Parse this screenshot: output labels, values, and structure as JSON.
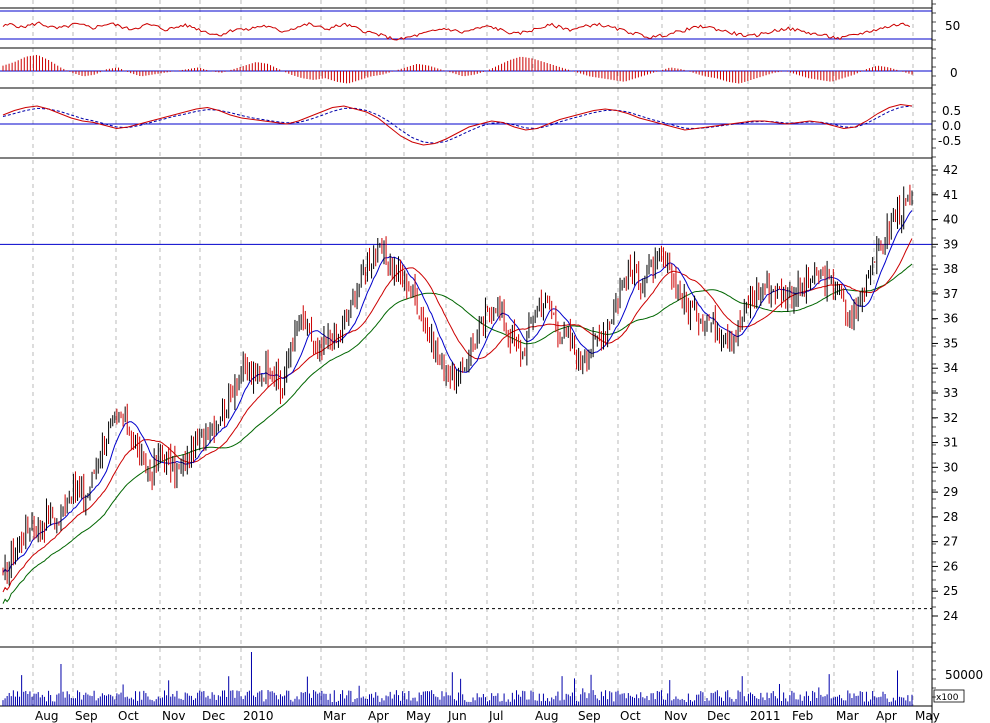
{
  "chart_data": {
    "type": "candlestick",
    "period": {
      "start": "2009-07-15",
      "end": "2011-04-29"
    },
    "x_axis": {
      "labels": [
        "Aug",
        "Sep",
        "Oct",
        "Nov",
        "Dec",
        "2010",
        "Mar",
        "Apr",
        "May",
        "Jun",
        "Jul",
        "Aug",
        "Sep",
        "Oct",
        "Nov",
        "Dec",
        "2011",
        "Feb",
        "Mar",
        "Apr",
        "May"
      ]
    },
    "panels": {
      "oscillator": {
        "ylim": [
          0,
          100
        ],
        "tick_labels": [
          "50"
        ],
        "reference_lines": [
          70,
          30
        ],
        "color": "#cc0000",
        "values": [
          62,
          66,
          60,
          64,
          68,
          62,
          58,
          61,
          66,
          63,
          59,
          64,
          67,
          62,
          57,
          60,
          65,
          62,
          56,
          59,
          64,
          61,
          55,
          50,
          46,
          52,
          58,
          55,
          60,
          63,
          58,
          53,
          57,
          62,
          66,
          61,
          57,
          62,
          65,
          60,
          54,
          50,
          46,
          41,
          38,
          42,
          46,
          50,
          54,
          58,
          55,
          51,
          55,
          59,
          62,
          57,
          52,
          48,
          52,
          56,
          61,
          64,
          60,
          56,
          59,
          63,
          66,
          62,
          58,
          54,
          50,
          46,
          42,
          45,
          48,
          52,
          56,
          60,
          62,
          58,
          54,
          50,
          47,
          44,
          47,
          51,
          55,
          58,
          56,
          52,
          49,
          46,
          43,
          40,
          44,
          48,
          52,
          56,
          60,
          64,
          66,
          62
        ]
      },
      "histogram": {
        "tick_labels": [
          "0"
        ],
        "color": "#cc0000",
        "values": [
          0.3,
          0.5,
          0.8,
          0.9,
          0.6,
          0.2,
          -0.1,
          -0.3,
          -0.2,
          0.1,
          0.2,
          -0.1,
          -0.3,
          -0.2,
          -0.1,
          0.0,
          0.1,
          0.2,
          0.0,
          -0.1,
          0.1,
          0.3,
          0.5,
          0.4,
          0.1,
          -0.2,
          -0.4,
          -0.5,
          -0.4,
          -0.6,
          -0.7,
          -0.5,
          -0.3,
          -0.2,
          0.0,
          0.2,
          0.4,
          0.3,
          0.1,
          -0.1,
          -0.3,
          -0.2,
          0.0,
          0.3,
          0.6,
          0.8,
          0.7,
          0.5,
          0.3,
          0.1,
          -0.1,
          -0.3,
          -0.4,
          -0.5,
          -0.6,
          -0.4,
          -0.2,
          0.0,
          0.2,
          0.1,
          -0.1,
          -0.3,
          -0.4,
          -0.6,
          -0.7,
          -0.5,
          -0.3,
          -0.1,
          0.0,
          -0.2,
          -0.4,
          -0.5,
          -0.6,
          -0.4,
          -0.2,
          0.1,
          0.3,
          0.2,
          0.0,
          -0.2
        ]
      },
      "macd": {
        "ylim": [
          -1.0,
          1.1
        ],
        "tick_labels": [
          "0.5",
          "0.0",
          "-0.5"
        ],
        "reference_lines": [
          0
        ],
        "line_color": "#cc0000",
        "signal_color": "#0000aa",
        "line": [
          0.3,
          0.45,
          0.55,
          0.6,
          0.5,
          0.35,
          0.2,
          0.1,
          0.05,
          -0.05,
          -0.15,
          -0.1,
          0.0,
          0.1,
          0.2,
          0.3,
          0.4,
          0.5,
          0.55,
          0.45,
          0.3,
          0.2,
          0.15,
          0.1,
          0.05,
          0.0,
          0.1,
          0.25,
          0.4,
          0.55,
          0.6,
          0.5,
          0.4,
          0.2,
          -0.1,
          -0.4,
          -0.6,
          -0.7,
          -0.65,
          -0.5,
          -0.3,
          -0.1,
          0.0,
          0.1,
          0.05,
          -0.1,
          -0.2,
          -0.15,
          0.0,
          0.15,
          0.25,
          0.35,
          0.45,
          0.5,
          0.45,
          0.35,
          0.2,
          0.1,
          0.0,
          -0.1,
          -0.2,
          -0.15,
          -0.1,
          -0.05,
          0.0,
          0.05,
          0.1,
          0.1,
          0.05,
          0.0,
          0.05,
          0.1,
          0.05,
          -0.05,
          -0.15,
          -0.1,
          0.1,
          0.35,
          0.55,
          0.65,
          0.6
        ],
        "signal": [
          0.25,
          0.35,
          0.45,
          0.52,
          0.5,
          0.42,
          0.3,
          0.18,
          0.1,
          0.0,
          -0.1,
          -0.12,
          -0.05,
          0.05,
          0.15,
          0.25,
          0.33,
          0.42,
          0.48,
          0.46,
          0.38,
          0.28,
          0.2,
          0.14,
          0.08,
          0.04,
          0.05,
          0.15,
          0.28,
          0.42,
          0.52,
          0.52,
          0.45,
          0.3,
          0.08,
          -0.2,
          -0.45,
          -0.6,
          -0.64,
          -0.58,
          -0.42,
          -0.24,
          -0.08,
          0.03,
          0.05,
          -0.03,
          -0.13,
          -0.15,
          -0.06,
          0.07,
          0.18,
          0.28,
          0.38,
          0.45,
          0.46,
          0.4,
          0.28,
          0.16,
          0.06,
          -0.04,
          -0.14,
          -0.15,
          -0.12,
          -0.07,
          -0.02,
          0.03,
          0.07,
          0.09,
          0.07,
          0.03,
          0.04,
          0.07,
          0.06,
          0.0,
          -0.1,
          -0.11,
          0.02,
          0.22,
          0.42,
          0.56,
          0.6
        ]
      },
      "price": {
        "ylim": [
          23.5,
          42.5
        ],
        "tick_labels": [
          "24",
          "25",
          "26",
          "27",
          "28",
          "29",
          "30",
          "31",
          "32",
          "33",
          "34",
          "35",
          "36",
          "37",
          "38",
          "39",
          "40",
          "41",
          "42"
        ],
        "resistance": 39.0,
        "support": 24.3,
        "closes": [
          25.4,
          26.6,
          27.1,
          27.8,
          27.5,
          28.2,
          27.8,
          28.9,
          29.1,
          28.7,
          30.1,
          31.2,
          31.8,
          32.0,
          31.2,
          30.1,
          29.8,
          30.6,
          30.0,
          29.9,
          30.4,
          31.0,
          31.6,
          31.9,
          32.3,
          33.5,
          34.0,
          33.5,
          33.9,
          34.1,
          33.0,
          34.8,
          35.9,
          35.5,
          34.5,
          35.2,
          35.1,
          35.9,
          37.0,
          38.1,
          38.6,
          38.7,
          38.1,
          37.6,
          37.2,
          36.3,
          35.3,
          34.2,
          33.8,
          33.5,
          34.5,
          35.1,
          36.1,
          36.7,
          35.9,
          35.0,
          34.6,
          36.0,
          36.8,
          36.5,
          35.5,
          35.1,
          34.4,
          34.7,
          35.2,
          35.6,
          36.6,
          37.7,
          37.9,
          37.5,
          38.0,
          38.3,
          37.8,
          37.0,
          36.4,
          36.1,
          36.0,
          35.6,
          35.5,
          35.4,
          36.4,
          37.0,
          37.3,
          37.3,
          37.1,
          37.0,
          37.2,
          37.4,
          37.8,
          37.5,
          37.2,
          36.0,
          36.3,
          37.6,
          38.6,
          39.2,
          40.1,
          40.5,
          40.6
        ]
      },
      "volume": {
        "tick_labels": [
          "50000"
        ],
        "unit_label": "x100",
        "color": "#0000aa"
      }
    },
    "moving_averages": [
      {
        "color": "#0000cc"
      },
      {
        "color": "#cc0000"
      },
      {
        "color": "#006600"
      }
    ],
    "candle_colors": {
      "up": "#000000",
      "down": "#cc0000"
    }
  }
}
